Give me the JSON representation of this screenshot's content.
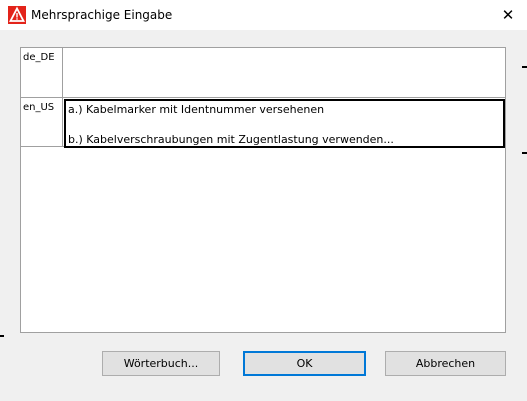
{
  "window": {
    "title": "Mehrsprachige Eingabe",
    "close_glyph": "✕"
  },
  "rows": [
    {
      "lang": "de_DE",
      "lines": [
        "",
        ""
      ]
    },
    {
      "lang": "en_US",
      "lines": [
        "a.) Kabelmarker mit Identnummer versehenen",
        "b.) Kabelverschraubungen mit Zugentlastung verwenden..."
      ]
    }
  ],
  "buttons": {
    "dictionary": "Wörterbuch...",
    "ok": "OK",
    "cancel": "Abbrechen"
  },
  "colors": {
    "focus_border": "#0078d7",
    "icon_red": "#e3231a"
  }
}
